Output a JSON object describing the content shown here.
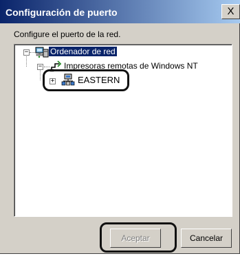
{
  "dialog": {
    "title": "Configuración de puerto",
    "close_glyph": "X",
    "instruction": "Configure el puerto de la red."
  },
  "tree": {
    "root": {
      "label": "Ordenador de red",
      "expander": "−",
      "icon": "network-computer-icon"
    },
    "child": {
      "label": "Impresoras remotas de Windows NT",
      "expander": "−",
      "icon": "printer-share-icon"
    },
    "grandchild": {
      "label": "EASTERN",
      "expander": "+",
      "icon": "server-icon"
    }
  },
  "buttons": {
    "accept": "Aceptar",
    "cancel": "Cancelar"
  },
  "colors": {
    "title_start": "#0a246a",
    "title_end": "#a6caf0",
    "dialog_bg": "#d4d0c8",
    "selection": "#0a246a"
  }
}
